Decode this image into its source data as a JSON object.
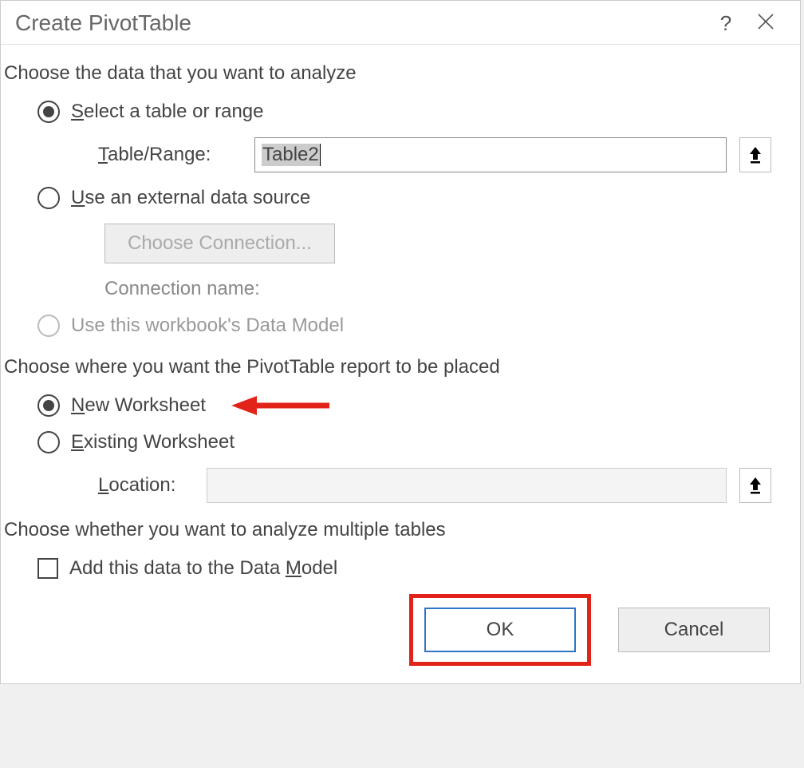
{
  "title": "Create PivotTable",
  "section1": "Choose the data that you want to analyze",
  "opt_select_range_pre": "S",
  "opt_select_range_rest": "elect a table or range",
  "table_range_label_pre": "T",
  "table_range_label_rest": "able/Range:",
  "table_range_value": "Table2",
  "opt_external_pre": "U",
  "opt_external_rest": "se an external data source",
  "choose_connection": "Choose Connection...",
  "connection_name": "Connection name:",
  "opt_data_model": "Use this workbook's Data Model",
  "section2": "Choose where you want the PivotTable report to be placed",
  "opt_new_ws_pre": "N",
  "opt_new_ws_rest": "ew Worksheet",
  "opt_existing_ws_pre": "E",
  "opt_existing_ws_rest": "xisting Worksheet",
  "location_label_pre": "L",
  "location_label_rest": "ocation:",
  "location_value": "",
  "section3": "Choose whether you want to analyze multiple tables",
  "opt_add_dm_pre": "Add this data to the Data ",
  "opt_add_dm_mid": "M",
  "opt_add_dm_rest": "odel",
  "ok": "OK",
  "cancel": "Cancel"
}
